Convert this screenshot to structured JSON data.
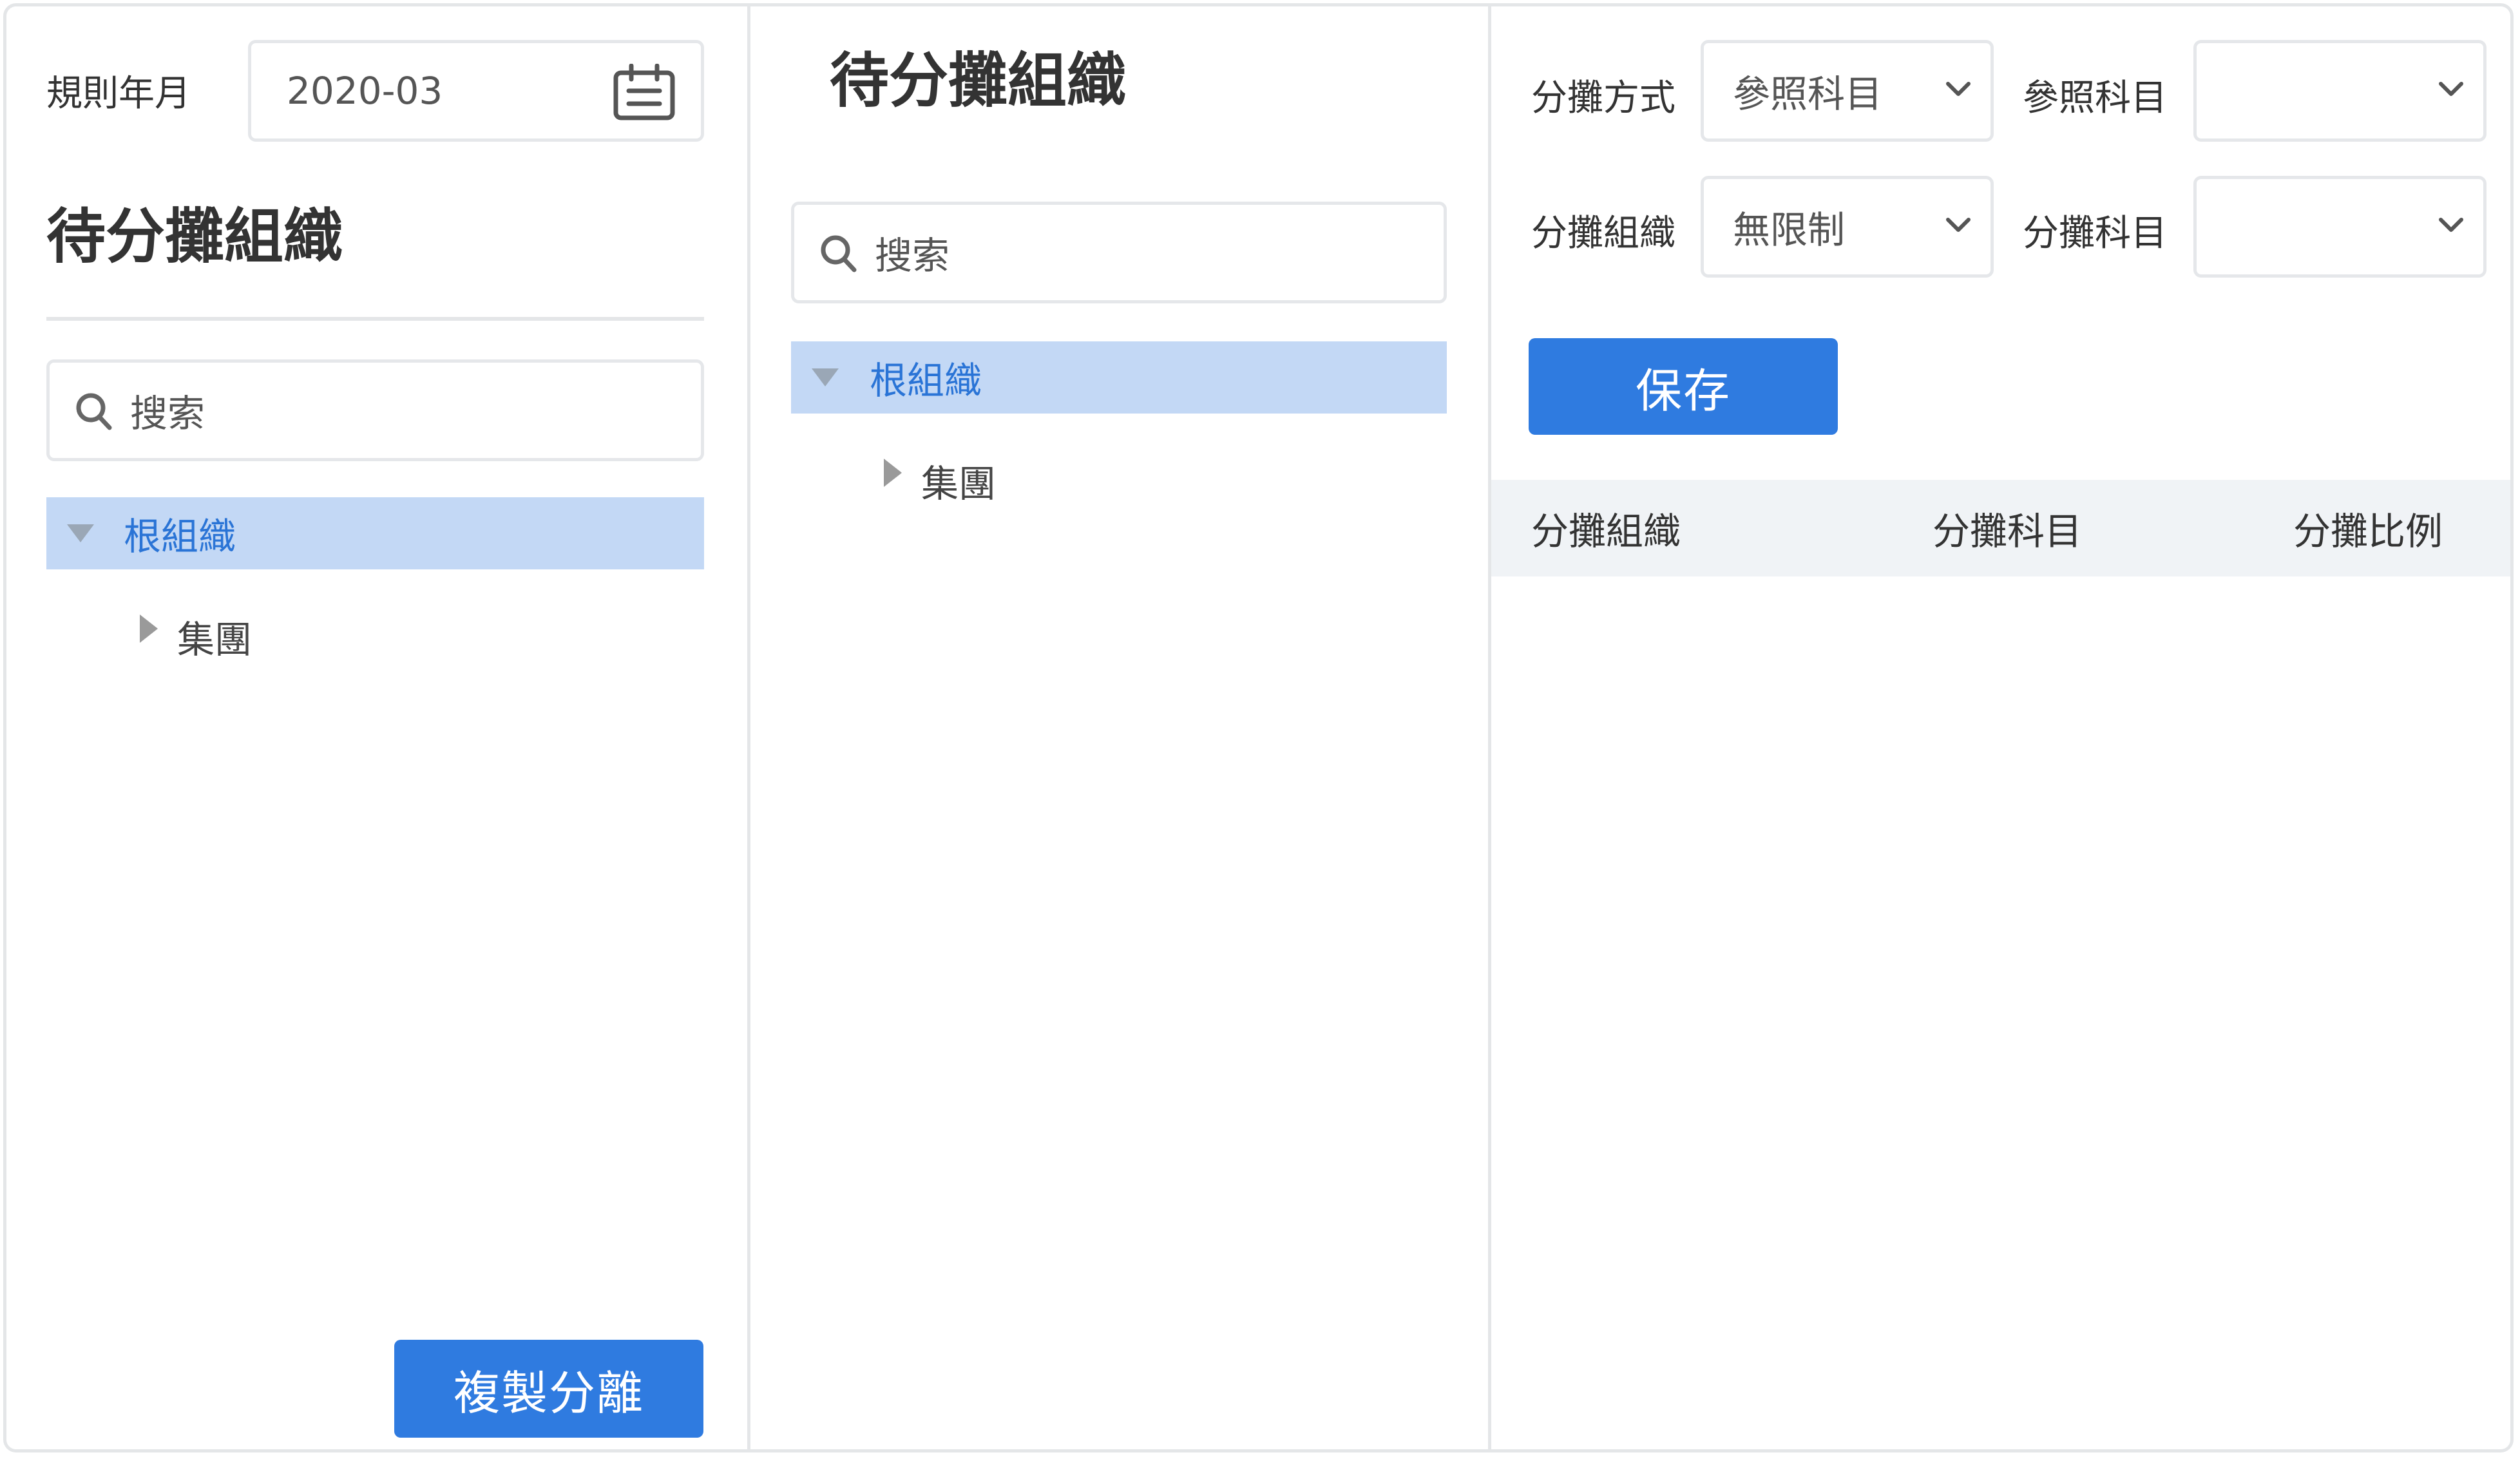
{
  "left_panel": {
    "rule_month_label": "規則年月",
    "rule_month_value": "2020-03",
    "title": "待分攤組織",
    "search_placeholder": "搜索",
    "tree": {
      "root_label": "根組織",
      "children": [
        "集團"
      ]
    },
    "copy_button_label": "複製分離"
  },
  "middle_panel": {
    "title": "待分攤組織",
    "search_placeholder": "搜索",
    "tree": {
      "root_label": "根組織",
      "children": [
        "集團"
      ]
    }
  },
  "right_panel": {
    "method_label": "分攤方式",
    "method_value": "參照科目",
    "ref_subject_label": "參照科目",
    "ref_subject_value": "",
    "org_label": "分攤組織",
    "org_value": "無限制",
    "subject_label": "分攤科目",
    "subject_value": "",
    "save_button_label": "保存",
    "table": {
      "columns": [
        "分攤組織",
        "分攤科目",
        "分攤比例"
      ],
      "rows": []
    }
  },
  "colors": {
    "accent": "#2f7be0",
    "tree_selected_bg": "#c3d8f5",
    "tree_selected_text": "#2a74d6",
    "border": "#e4e6e8",
    "table_header_bg": "#f0f3f6"
  }
}
